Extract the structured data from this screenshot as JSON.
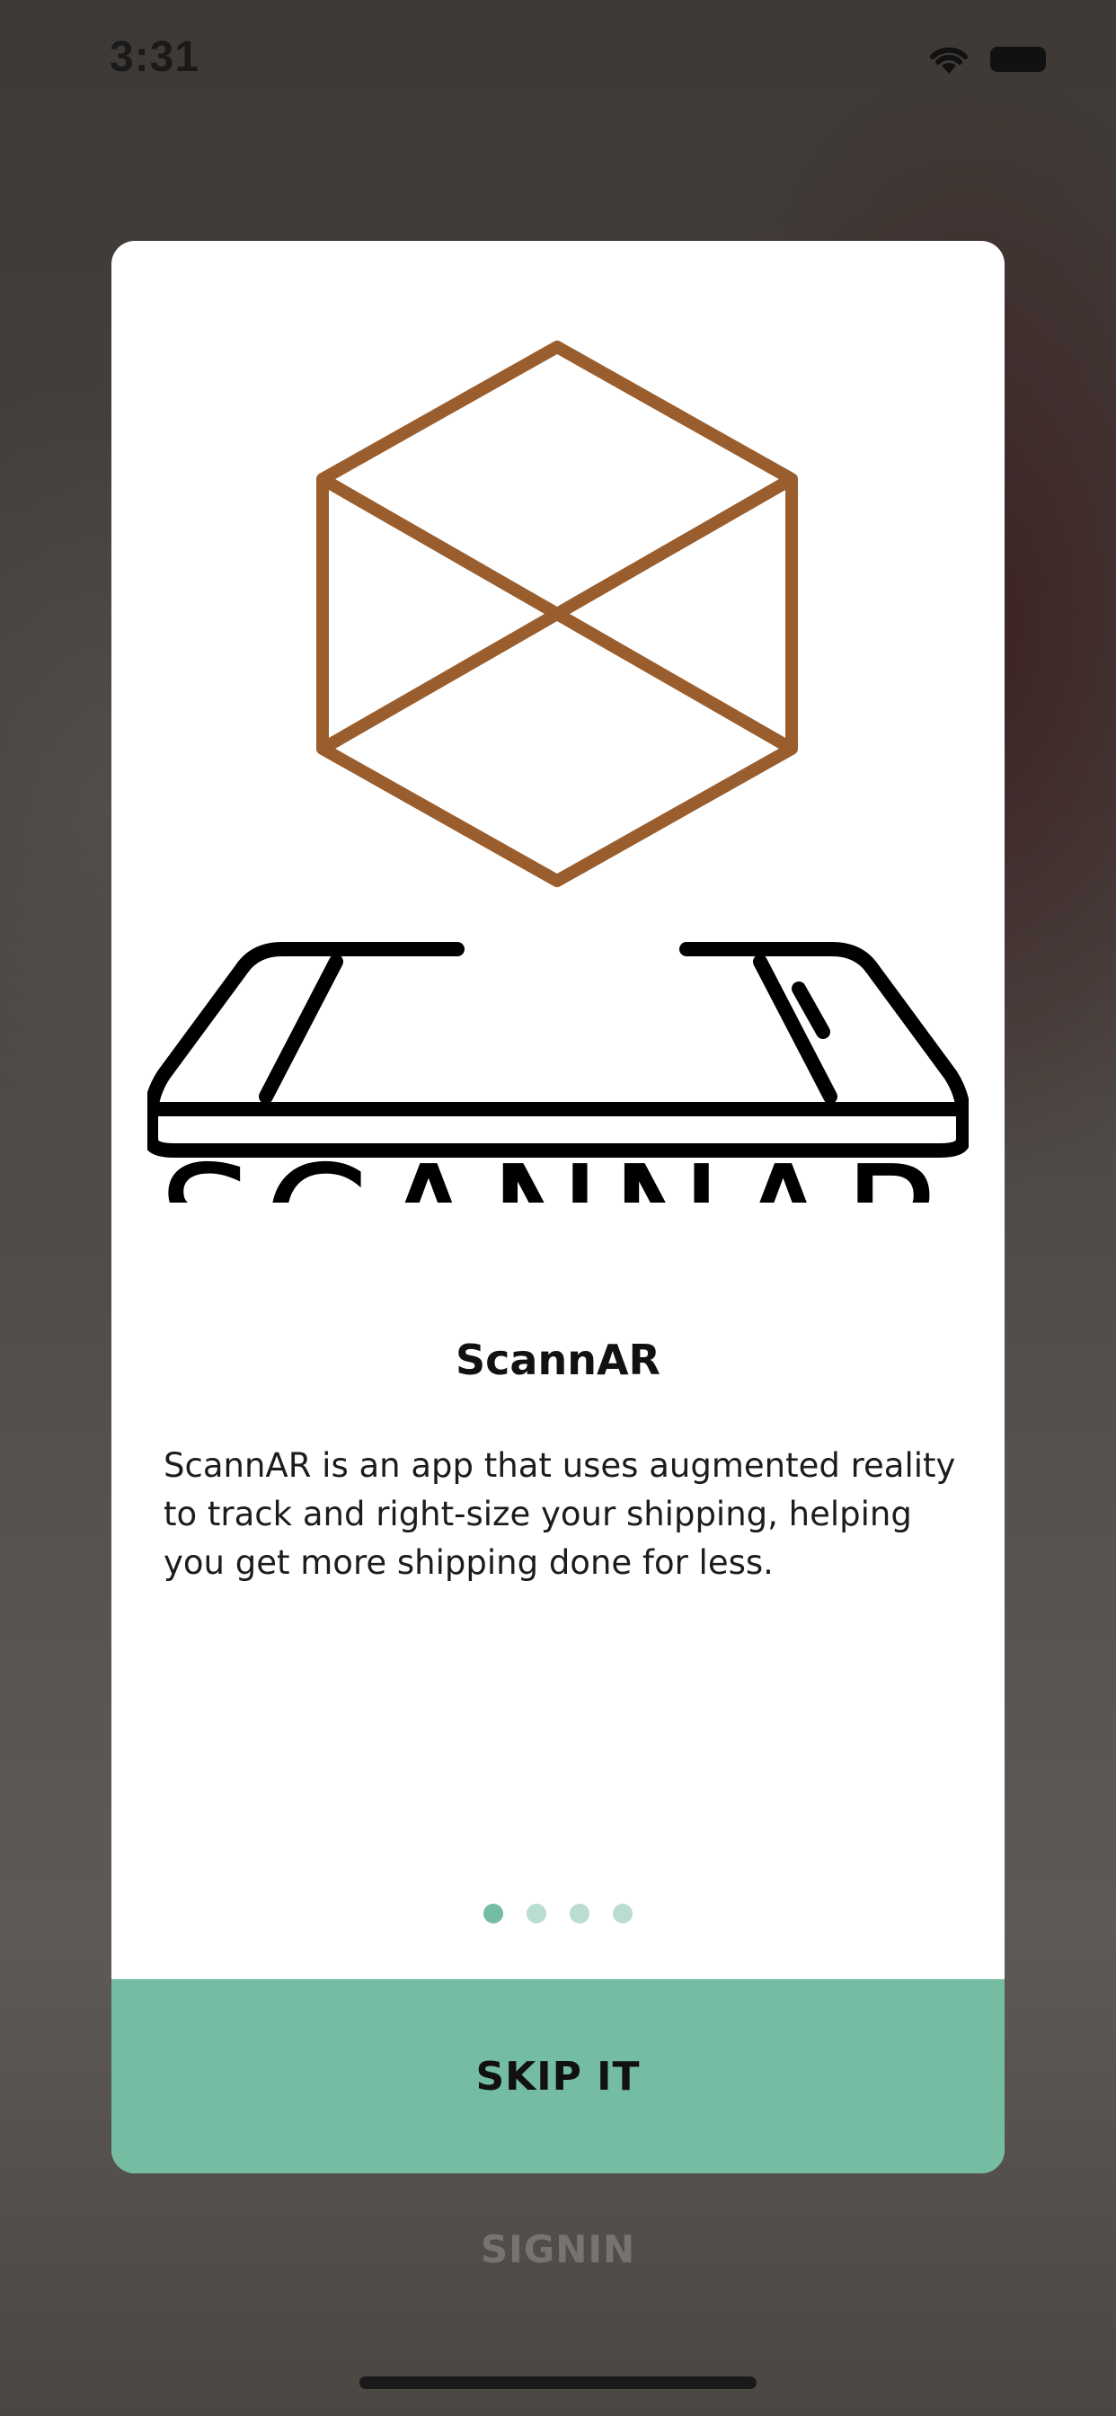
{
  "status_bar": {
    "time": "3:31",
    "wifi_icon": "wifi-icon",
    "battery_icon": "battery-icon"
  },
  "onboarding_card": {
    "logo_text": "SCANNAR",
    "title": "ScannAR",
    "description": "ScannAR is an app that uses augmented reality to track and right-size your shipping, helping you get more shipping done for less.",
    "pagination": {
      "count": 4,
      "active_index": 0
    },
    "skip_label": "SKIP IT"
  },
  "signin_label": "SIGNIN",
  "colors": {
    "accent": "#74bda3",
    "accent_light": "#b9ddd0",
    "logo_cube": "#9a5e2e",
    "logo_dark": "#000000"
  }
}
